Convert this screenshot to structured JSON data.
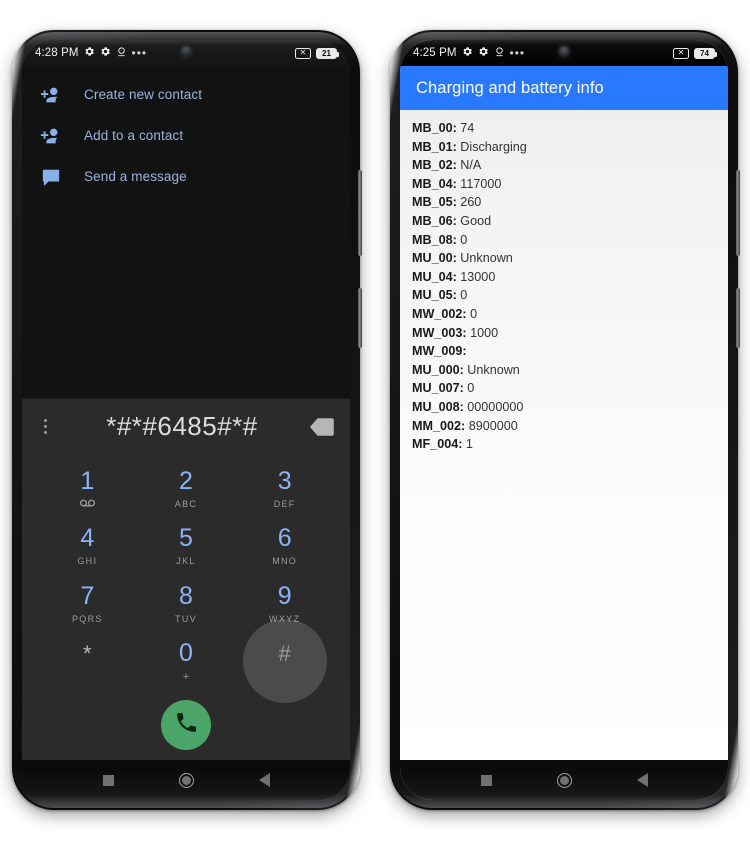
{
  "left_phone": {
    "status_bar": {
      "time": "4:28 PM",
      "icons": [
        "gear-icon",
        "gear-icon",
        "location-icon",
        "overflow-dots-icon"
      ],
      "dots": "•••",
      "no_sim": "✕",
      "battery": "21"
    },
    "suggestions": [
      {
        "icon": "person-add-icon",
        "label": "Create new contact"
      },
      {
        "icon": "person-add-icon",
        "label": "Add to a contact"
      },
      {
        "icon": "message-icon",
        "label": "Send a message"
      }
    ],
    "digit_bar": {
      "menu_icon": "kebab-menu-icon",
      "digits": "*#*#6485#*#",
      "backspace_icon": "backspace-icon"
    },
    "keypad": [
      {
        "num": "1",
        "sub": "⊙⊙",
        "voicemail": true
      },
      {
        "num": "2",
        "sub": "ABC"
      },
      {
        "num": "3",
        "sub": "DEF"
      },
      {
        "num": "4",
        "sub": "GHI"
      },
      {
        "num": "5",
        "sub": "JKL"
      },
      {
        "num": "6",
        "sub": "MNO"
      },
      {
        "num": "7",
        "sub": "PQRS"
      },
      {
        "num": "8",
        "sub": "TUV"
      },
      {
        "num": "9",
        "sub": "WXYZ"
      },
      {
        "num": "*",
        "sub": ""
      },
      {
        "num": "0",
        "sub": "+"
      },
      {
        "num": "#",
        "sub": "",
        "pressed": true
      }
    ],
    "call_button": {
      "icon": "phone-call-icon",
      "color": "#4ca568"
    },
    "nav_bar": [
      "recents-button",
      "home-button",
      "back-button"
    ]
  },
  "right_phone": {
    "status_bar": {
      "time": "4:25 PM",
      "icons": [
        "gear-icon",
        "gear-icon",
        "location-icon",
        "overflow-dots-icon"
      ],
      "dots": "•••",
      "no_sim": "✕",
      "battery": "74"
    },
    "app_bar": {
      "title": "Charging and battery info",
      "color": "#2979ff"
    },
    "info_rows": [
      {
        "key": "MB_00:",
        "value": "74"
      },
      {
        "key": "MB_01:",
        "value": "Discharging"
      },
      {
        "key": "MB_02:",
        "value": "N/A"
      },
      {
        "key": "MB_04:",
        "value": "117000"
      },
      {
        "key": "MB_05:",
        "value": "260"
      },
      {
        "key": "MB_06:",
        "value": "Good"
      },
      {
        "key": "MB_08:",
        "value": "0"
      },
      {
        "key": "MU_00:",
        "value": "Unknown"
      },
      {
        "key": "MU_04:",
        "value": "13000"
      },
      {
        "key": "MU_05:",
        "value": "0"
      },
      {
        "key": "MW_002:",
        "value": "0"
      },
      {
        "key": "MW_003:",
        "value": "1000"
      },
      {
        "key": "MW_009:",
        "value": ""
      },
      {
        "key": "MU_000:",
        "value": "Unknown"
      },
      {
        "key": "MU_007:",
        "value": "0"
      },
      {
        "key": "MU_008:",
        "value": "00000000"
      },
      {
        "key": "MM_002:",
        "value": "8900000"
      },
      {
        "key": "MF_004:",
        "value": "1"
      }
    ],
    "nav_bar": [
      "recents-button",
      "home-button",
      "back-button"
    ]
  }
}
